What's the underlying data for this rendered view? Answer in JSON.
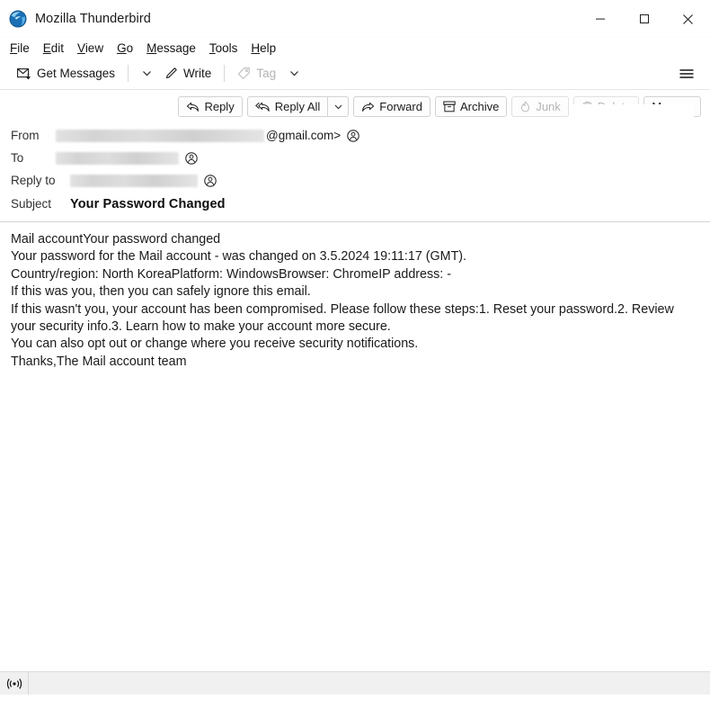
{
  "window": {
    "title": "Mozilla Thunderbird",
    "logo_icon": "thunderbird-logo-icon",
    "controls": {
      "minimize": "minimize-icon",
      "maximize": "maximize-icon",
      "close": "close-icon"
    }
  },
  "menubar": {
    "items": [
      {
        "label": "File",
        "accesskey": "F",
        "rest": "ile"
      },
      {
        "label": "Edit",
        "accesskey": "E",
        "rest": "dit"
      },
      {
        "label": "View",
        "accesskey": "V",
        "rest": "iew"
      },
      {
        "label": "Go",
        "accesskey": "G",
        "rest": "o"
      },
      {
        "label": "Message",
        "accesskey": "M",
        "rest": "essage"
      },
      {
        "label": "Tools",
        "accesskey": "T",
        "rest": "ools"
      },
      {
        "label": "Help",
        "accesskey": "H",
        "rest": "elp"
      }
    ]
  },
  "main_toolbar": {
    "get_messages_label": "Get Messages",
    "get_messages_icon": "get-messages-icon",
    "get_messages_chevron": "chevron-down-icon",
    "write_label": "Write",
    "write_icon": "pencil-icon",
    "tag_label": "Tag",
    "tag_icon": "tag-icon",
    "tag_chevron": "chevron-down-icon",
    "tag_disabled": true,
    "app_menu_icon": "hamburger-menu-icon"
  },
  "message_actions": [
    {
      "label": "Reply",
      "icon": "reply-icon",
      "disabled": false,
      "has_dropdown": false
    },
    {
      "label": "Reply All",
      "icon": "reply-all-icon",
      "disabled": false,
      "has_dropdown": true
    },
    {
      "label": "Forward",
      "icon": "forward-icon",
      "disabled": false,
      "has_dropdown": false
    },
    {
      "label": "Archive",
      "icon": "archive-icon",
      "disabled": false,
      "has_dropdown": false
    },
    {
      "label": "Junk",
      "icon": "junk-flame-icon",
      "disabled": true,
      "has_dropdown": false
    },
    {
      "label": "Delete",
      "icon": "trash-icon",
      "disabled": true,
      "has_dropdown": false
    },
    {
      "label": "More",
      "icon": "",
      "disabled": false,
      "has_dropdown": true
    }
  ],
  "headers": {
    "from_label": "From",
    "from_value_redacted": true,
    "from_domain_suffix": "@gmail.com>",
    "to_label": "To",
    "to_value_redacted": true,
    "reply_to_label": "Reply to",
    "reply_to_value_redacted": true,
    "subject_label": "Subject",
    "subject_value": "Your Password Changed",
    "contact_icon": "contact-person-icon"
  },
  "body": {
    "lines": [
      "Mail accountYour password changed",
      "Your password for the Mail account - was changed on 3.5.2024 19:11:17 (GMT).",
      "Country/region: North KoreaPlatform: WindowsBrowser: ChromeIP address: -",
      "If this was you, then you can safely ignore this email.",
      "If this wasn't you, your account has been compromised. Please follow these steps:1. Reset your password.2. Review your security info.3. Learn how to make your account more secure.",
      "You can also opt out or change where you receive security notifications.",
      "Thanks,The Mail account team"
    ]
  },
  "statusbar": {
    "icon": "broadcast-signal-icon",
    "text": ""
  },
  "colors": {
    "accent_blue": "#0a84c1",
    "window_bg": "#ffffff",
    "statusbar_bg": "#f0f0f0",
    "border": "#d6d6d6",
    "disabled_text": "#b5b5b5"
  }
}
